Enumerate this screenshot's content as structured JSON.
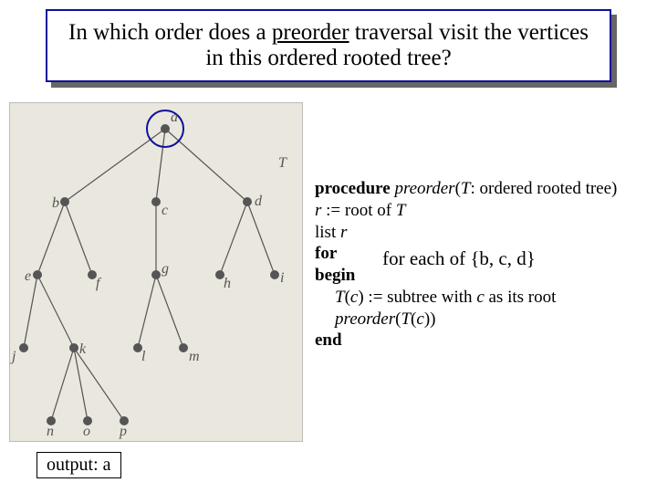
{
  "title": {
    "pre": "In which order does a ",
    "underlined": "preorder",
    "post": " traversal visit the vertices in this ordered rooted tree?"
  },
  "tree": {
    "nodes": {
      "a": "a",
      "b": "b",
      "c": "c",
      "d": "d",
      "e": "e",
      "f": "f",
      "g": "g",
      "h": "h",
      "i": "i",
      "j": "j",
      "k": "k",
      "l": "l",
      "m": "m",
      "n": "n",
      "o": "o",
      "p": "p"
    },
    "T": "T",
    "highlighted": "a"
  },
  "pseudo": {
    "proc_kw": "procedure",
    "proc_name": "preorder",
    "proc_sig_open": "(",
    "proc_T": "T",
    "proc_sig_rest": ": ordered rooted tree)",
    "line_r1a": "r",
    "line_r1b": " := root of ",
    "line_r1c": "T",
    "line_list_a": "list ",
    "line_list_b": "r",
    "for_kw": "for",
    "begin_kw": "begin",
    "tc_a": "T",
    "tc_b": "(",
    "tc_c": "c",
    "tc_d": ") := subtree with ",
    "tc_e": "c",
    "tc_f": " as its root",
    "call_a": "preorder",
    "call_b": "(",
    "call_c": "T",
    "call_d": "(",
    "call_e": "c",
    "call_f": "))",
    "end_kw": "end"
  },
  "overlay": {
    "pre": "for each of {",
    "items": "b, c, d",
    "post": "}"
  },
  "output": {
    "label": "output: ",
    "value": "a"
  }
}
